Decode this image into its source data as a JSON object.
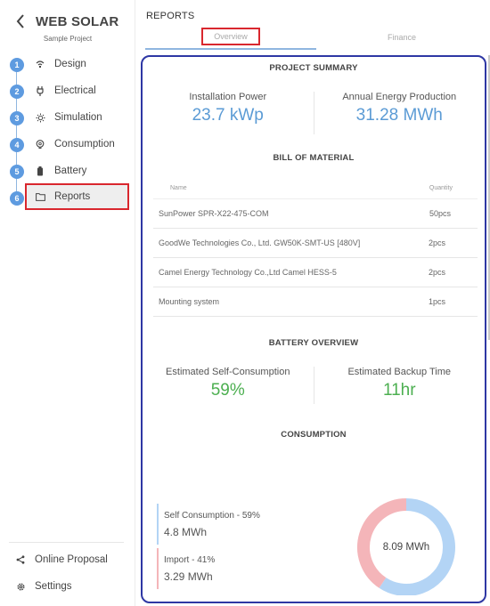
{
  "sidebar": {
    "title": "WEB SOLAR",
    "subtitle": "Sample Project",
    "steps": [
      {
        "number": "1",
        "label": "Design",
        "icon": "home-wifi-icon"
      },
      {
        "number": "2",
        "label": "Electrical",
        "icon": "plug-icon"
      },
      {
        "number": "3",
        "label": "Simulation",
        "icon": "sun-icon"
      },
      {
        "number": "4",
        "label": "Consumption",
        "icon": "bulb-icon"
      },
      {
        "number": "5",
        "label": "Battery",
        "icon": "battery-icon"
      },
      {
        "number": "6",
        "label": "Reports",
        "icon": "folder-icon",
        "active": true
      }
    ],
    "footer": [
      {
        "label": "Online Proposal",
        "icon": "share-icon"
      },
      {
        "label": "Settings",
        "icon": "gear-icon"
      }
    ]
  },
  "main": {
    "title": "REPORTS",
    "tabs": [
      {
        "label": "Overview",
        "active": true
      },
      {
        "label": "Finance",
        "active": false
      }
    ],
    "project_summary": {
      "title": "PROJECT SUMMARY",
      "installation_power_label": "Installation Power",
      "installation_power_value": "23.7 kWp",
      "annual_energy_label": "Annual Energy Production",
      "annual_energy_value": "31.28 MWh"
    },
    "bill_of_material": {
      "title": "BILL OF MATERIAL",
      "columns": [
        "Name",
        "Quantity"
      ],
      "rows": [
        {
          "name": "SunPower SPR-X22-475-COM",
          "quantity": "50pcs"
        },
        {
          "name": "GoodWe Technologies Co., Ltd. GW50K-SMT-US [480V]",
          "quantity": "2pcs"
        },
        {
          "name": "Camel Energy Technology Co.,Ltd Camel HESS-5",
          "quantity": "2pcs"
        },
        {
          "name": "Mounting system",
          "quantity": "1pcs"
        }
      ]
    },
    "battery_overview": {
      "title": "BATTERY OVERVIEW",
      "self_consumption_label": "Estimated Self-Consumption",
      "self_consumption_value": "59%",
      "backup_time_label": "Estimated Backup Time",
      "backup_time_value": "11hr"
    },
    "consumption": {
      "title": "CONSUMPTION",
      "total": "8.09 MWh",
      "items": [
        {
          "label": "Self Consumption - 59%",
          "value": "4.8 MWh",
          "color": "#b3d4f5"
        },
        {
          "label": "Import - 41%",
          "value": "3.29 MWh",
          "color": "#f4b5b9"
        }
      ]
    }
  },
  "colors": {
    "accent_blue": "#5b9bd5",
    "accent_green": "#4caf50",
    "step_circle": "#5e9be0",
    "card_border": "#2e37a4",
    "highlight_red": "#d9272e"
  },
  "chart_data": {
    "type": "pie",
    "title": "CONSUMPTION",
    "center_label": "8.09 MWh",
    "categories": [
      "Self Consumption",
      "Import"
    ],
    "values": [
      4.8,
      3.29
    ],
    "percentages": [
      59,
      41
    ],
    "units": "MWh",
    "colors": [
      "#b3d4f5",
      "#f4b5b9"
    ],
    "legend": "left"
  }
}
